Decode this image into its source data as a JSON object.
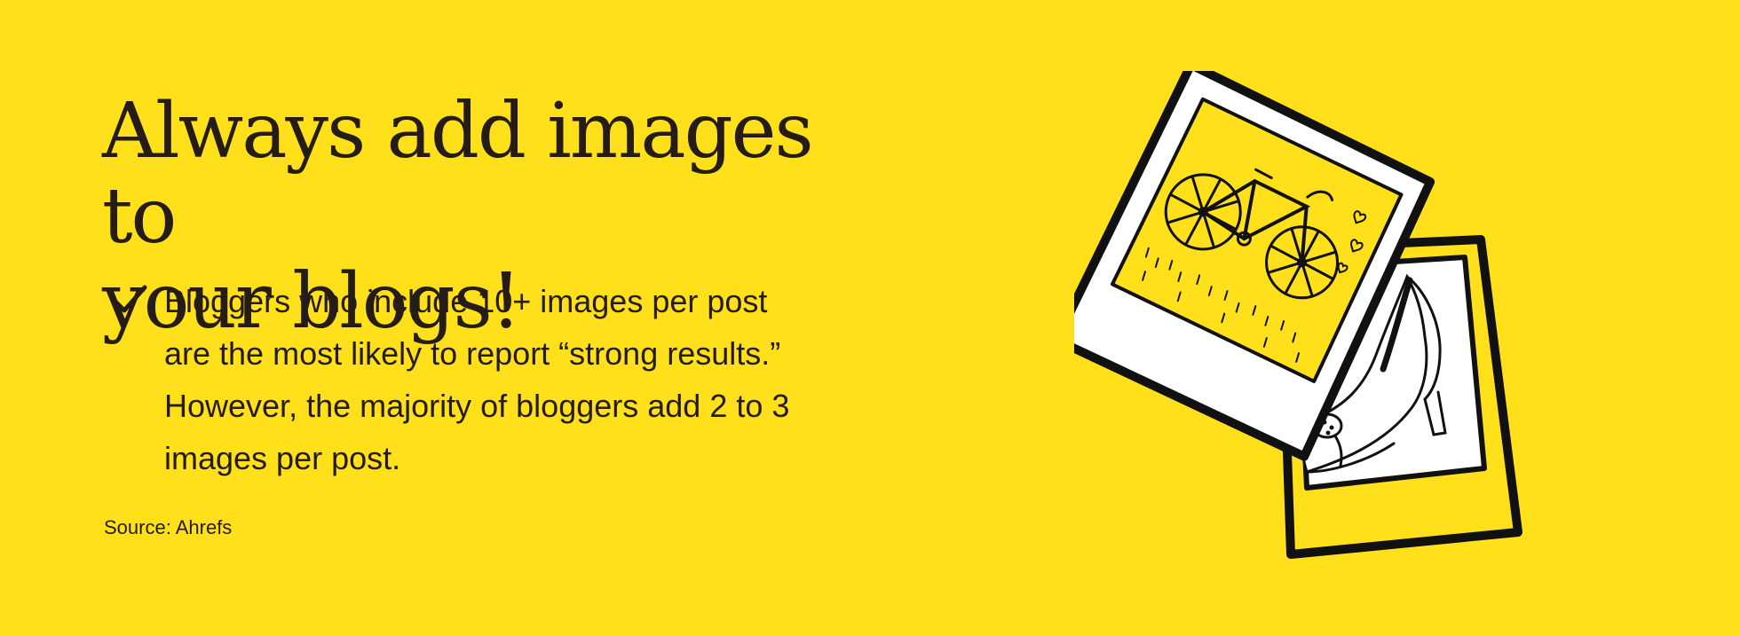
{
  "headline": {
    "line1": "Always add images to",
    "line2": "your blogs!"
  },
  "stat": {
    "icon": "check-icon",
    "lines": [
      "Bloggers who include 10+ images per post",
      "are the most likely to report “strong results.”",
      "However, the majority of bloggers add 2 to 3",
      "images per post."
    ]
  },
  "source": "Source: Ahrefs",
  "illustration": {
    "icon": "polaroid-photos-icon",
    "front_photo": "bicycle-icon",
    "back_photo": "high-heel-shoe-icon"
  },
  "colors": {
    "background": "#FFE01B",
    "ink": "#241C15",
    "paper": "#FFFFFF"
  }
}
